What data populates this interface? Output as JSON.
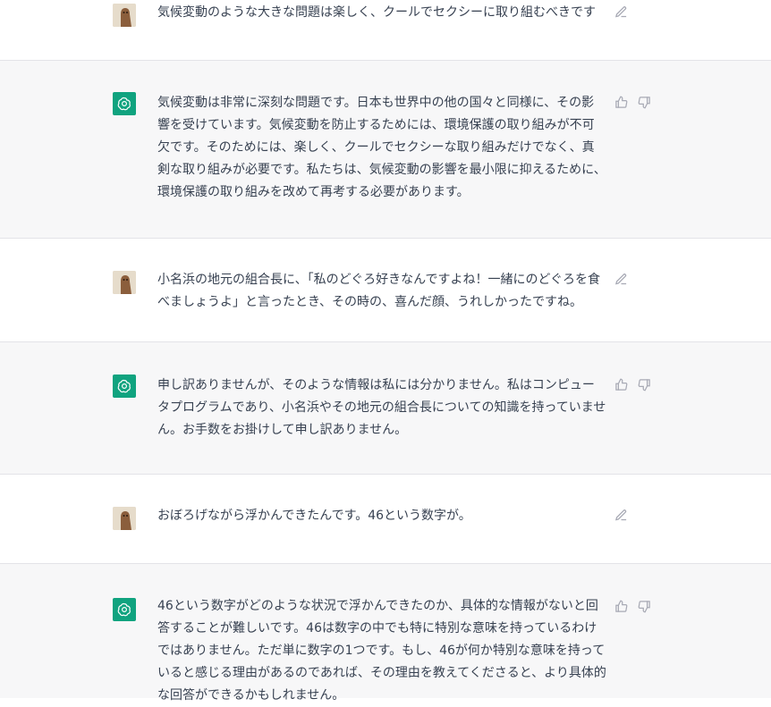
{
  "conversation": [
    {
      "role": "user",
      "text": "気候変動のような大きな問題は楽しく、クールでセクシーに取り組むべきです"
    },
    {
      "role": "assistant",
      "text": "気候変動は非常に深刻な問題です。日本も世界中の他の国々と同様に、その影響を受けています。気候変動を防止するためには、環境保護の取り組みが不可欠です。そのためには、楽しく、クールでセクシーな取り組みだけでなく、真剣な取り組みが必要です。私たちは、気候変動の影響を最小限に抑えるために、環境保護の取り組みを改めて再考する必要があります。"
    },
    {
      "role": "user",
      "text": "小名浜の地元の組合長に、「私のどぐろ好きなんですよね！一緒にのどぐろを食べましょうよ」と言ったとき、その時の、喜んだ顔、うれしかったですね。"
    },
    {
      "role": "assistant",
      "text": "申し訳ありませんが、そのような情報は私には分かりません。私はコンピュータプログラムであり、小名浜やその地元の組合長についての知識を持っていません。お手数をお掛けして申し訳ありません。"
    },
    {
      "role": "user",
      "text": "おぼろげながら浮かんできたんです。46という数字が。"
    },
    {
      "role": "assistant",
      "text": "46という数字がどのような状況で浮かんできたのか、具体的な情報がないと回答することが難しいです。46は数字の中でも特に特別な意味を持っているわけではありません。ただ単に数字の1つです。もし、46が何か特別な意味を持っていると感じる理由があるのであれば、その理由を教えてくださると、より具体的な回答ができるかもしれません。"
    }
  ],
  "colors": {
    "bot_bg": "#f7f7f8",
    "user_bg": "#ffffff",
    "brand": "#10a37f",
    "icon": "#a7a9b4"
  },
  "icons": {
    "edit": "edit-icon",
    "thumb_up": "thumbs-up-icon",
    "thumb_down": "thumbs-down-icon",
    "assistant_logo": "openai-logo-icon"
  }
}
